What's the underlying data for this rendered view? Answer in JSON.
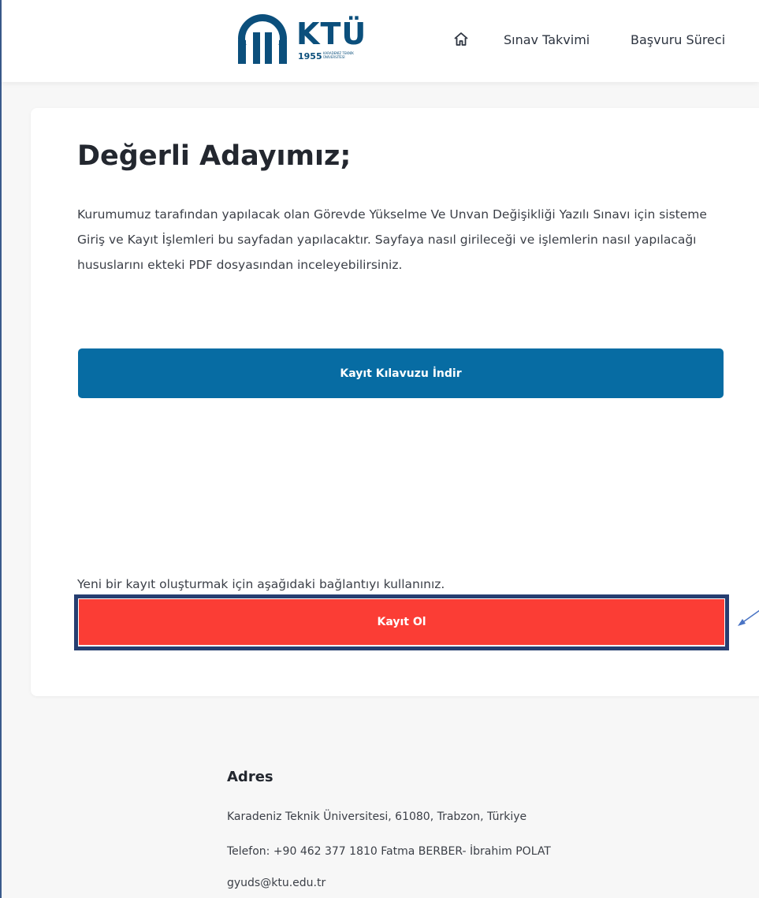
{
  "header": {
    "logo": {
      "name": "KTÜ",
      "year": "1955",
      "subtitle": "KARADENİZ TEKNİK ÜNİVERSİTESİ"
    },
    "nav": {
      "home_icon": "home-icon",
      "items": [
        "Sınav Takvimi",
        "Başvuru Süreci"
      ]
    }
  },
  "main": {
    "title": "Değerli Adayımız;",
    "intro": "Kurumumuz tarafından yapılacak olan Görevde Yükselme Ve Unvan Değişikliği Yazılı Sınavı için sisteme Giriş ve Kayıt İşlemleri bu sayfadan yapılacaktır. Sayfaya nasıl girileceği ve işlemlerin nasıl yapılacağı hususlarını ekteki PDF dosyasından inceleyebilirsiniz.",
    "guide_button": "Kayıt Kılavuzu İndir",
    "new_record_text": "Yeni bir kayıt oluşturmak için aşağıdaki bağlantıyı kullanınız.",
    "register_button": "Kayıt Ol"
  },
  "footer": {
    "heading": "Adres",
    "address": "Karadeniz Teknik Üniversitesi, 61080, Trabzon, Türkiye",
    "phone": "Telefon: +90 462 377 1810 Fatma BERBER- İbrahim POLAT",
    "email": "gyuds@ktu.edu.tr"
  },
  "colors": {
    "primary_blue": "#076ca3",
    "register_red": "#fb3d35",
    "highlight_border": "#263e70",
    "logo_blue": "#0b4f7c"
  }
}
